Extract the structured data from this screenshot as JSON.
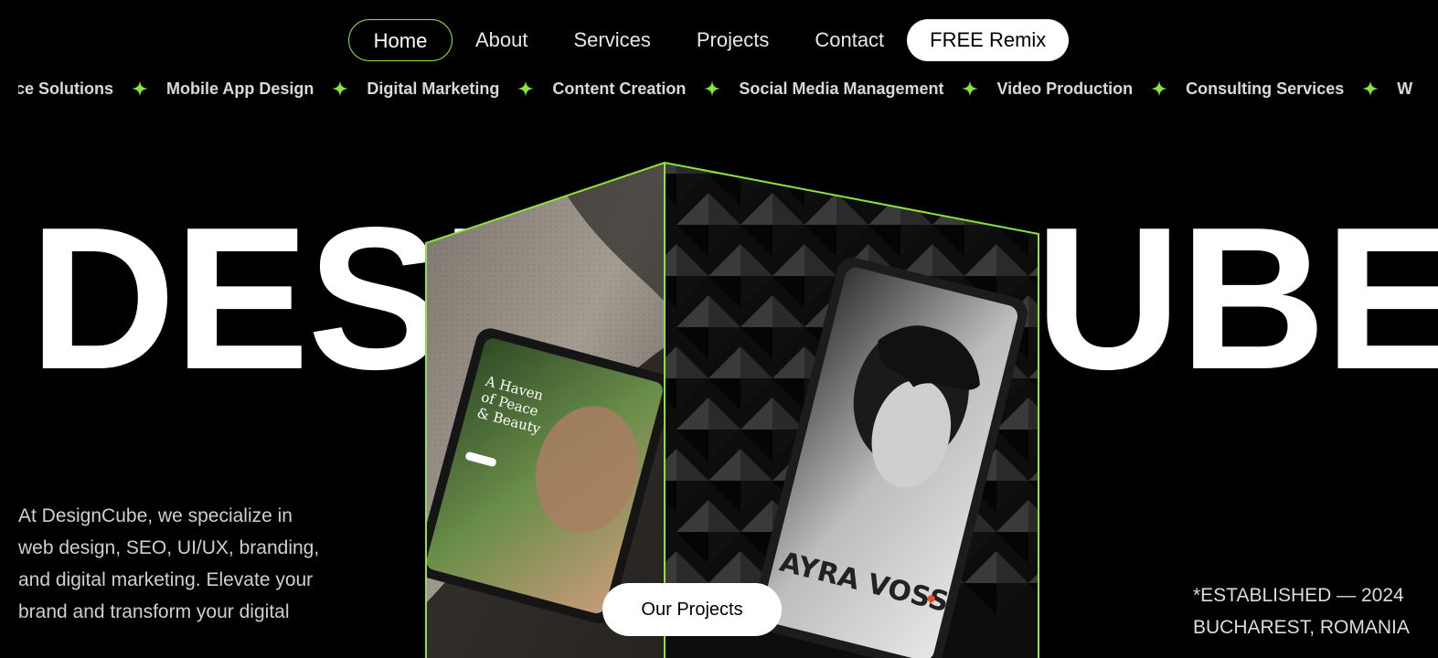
{
  "nav": {
    "items": [
      {
        "label": "Home",
        "active": true
      },
      {
        "label": "About"
      },
      {
        "label": "Services"
      },
      {
        "label": "Projects"
      },
      {
        "label": "Contact"
      }
    ],
    "cta_label": "FREE Remix"
  },
  "ticker": {
    "items": [
      "mmerce Solutions",
      "Mobile App Design",
      "Digital Marketing",
      "Content Creation",
      "Social Media Management",
      "Video Production",
      "Consulting Services",
      "W"
    ],
    "star_color": "#8be33b"
  },
  "hero": {
    "title_left": "DESI",
    "title_right": "UBE",
    "cta_label": "Our Projects",
    "description": "At DesignCube, we specialize in web design, SEO, UI/UX, branding, and digital marketing. Elevate your brand and transform your digital",
    "established": "*ESTABLISHED — 2024",
    "location": "BUCHAREST, ROMANIA"
  },
  "mockups": {
    "left_screen": {
      "heading": "A Haven of Peace & Beauty"
    },
    "right_screen": {
      "name": "AYRA VOSS"
    }
  },
  "colors": {
    "accent": "#8be33b",
    "background": "#000000"
  }
}
